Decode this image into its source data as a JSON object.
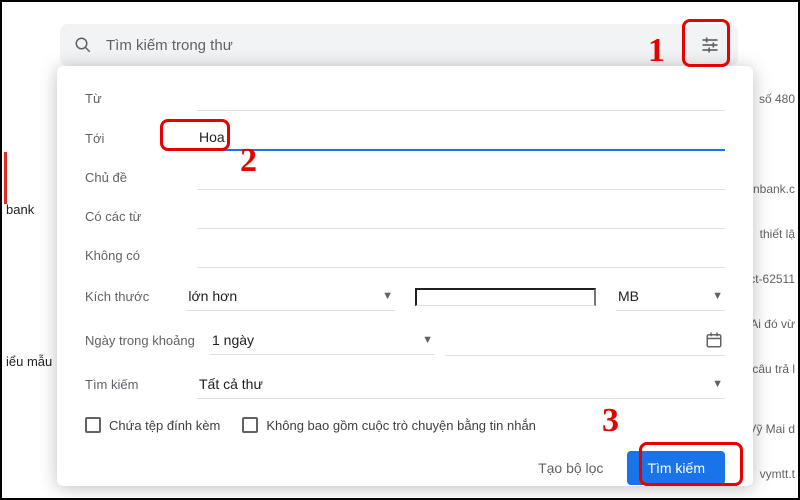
{
  "searchbar": {
    "placeholder": "Tìm kiếm trong thư"
  },
  "form": {
    "from_label": "Từ",
    "from_value": "",
    "to_label": "Tới",
    "to_value": "Hoa",
    "subject_label": "Chủ đề",
    "subject_value": "",
    "has_words_label": "Có các từ",
    "has_words_value": "",
    "doesnt_have_label": "Không có",
    "doesnt_have_value": "",
    "size_label": "Kích thước",
    "size_op": "lớn hơn",
    "size_value": "",
    "size_unit": "MB",
    "date_label": "Ngày trong khoảng",
    "date_value": "1 ngày",
    "search_in_label": "Tìm kiếm",
    "search_in_value": "Tất cả thư",
    "has_attachment_label": "Chứa tệp đính kèm",
    "exclude_chats_label": "Không bao gồm cuộc trò chuyện bằng tin nhắn",
    "create_filter_label": "Tạo bộ lọc",
    "search_button_label": "Tìm kiếm"
  },
  "bg": {
    "r1": "số 480",
    "r2": "nbank.c",
    "r3": "thiết lậ",
    "r4": "ct-62511",
    "r5": "Ai đó vừ",
    "r6": "câu trả l",
    "r7": "Vỹ Mai d",
    "r8": "vymtt.t"
  },
  "sidebar": {
    "item1": "bank",
    "item2": "iểu mẫu"
  },
  "annotations": {
    "n1": "1",
    "n2": "2",
    "n3": "3"
  }
}
